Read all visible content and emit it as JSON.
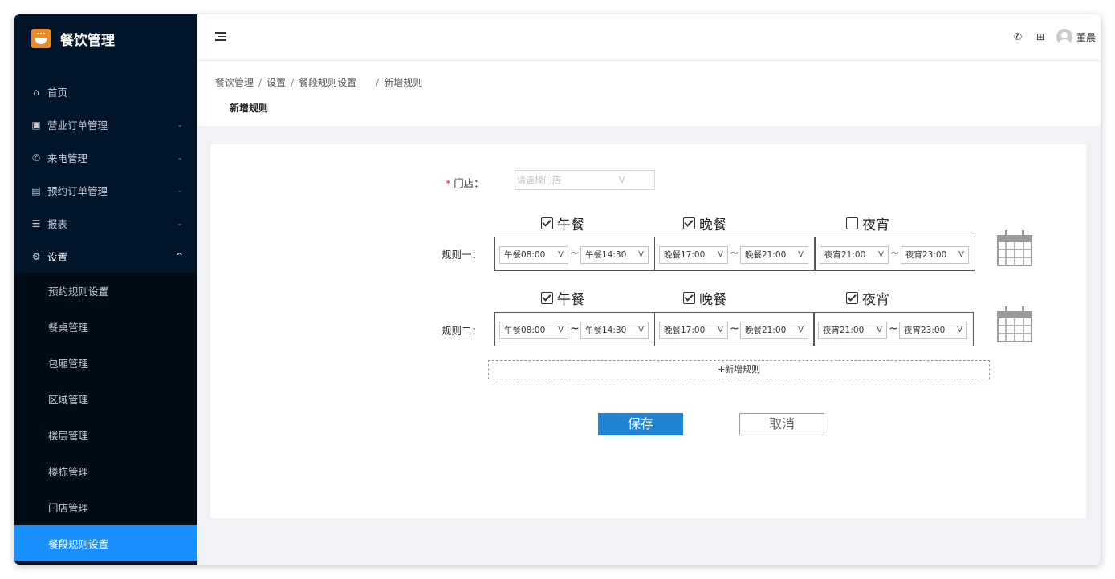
{
  "app": {
    "title": "餐饮管理"
  },
  "sidebar": {
    "items": [
      {
        "label": "首页",
        "icon": "home-icon"
      },
      {
        "label": "营业订单管理",
        "icon": "receipt-icon"
      },
      {
        "label": "来电管理",
        "icon": "phone-icon"
      },
      {
        "label": "预约订单管理",
        "icon": "calendar-list-icon"
      },
      {
        "label": "报表",
        "icon": "list-icon"
      },
      {
        "label": "设置",
        "icon": "gear-icon"
      }
    ],
    "submenu": [
      {
        "label": "预约规则设置"
      },
      {
        "label": "餐桌管理"
      },
      {
        "label": "包厢管理"
      },
      {
        "label": "区域管理"
      },
      {
        "label": "楼层管理"
      },
      {
        "label": "楼栋管理"
      },
      {
        "label": "门店管理"
      },
      {
        "label": "餐段规则设置"
      }
    ]
  },
  "header": {
    "username": "董晨"
  },
  "breadcrumb": [
    "餐饮管理",
    "设置",
    "餐段规则设置",
    "新增规则"
  ],
  "page_title": "新增规则",
  "form": {
    "store_label": "门店：",
    "store_placeholder": "请选择门店",
    "select_arrow": "V",
    "rules": [
      {
        "label": "规则一：",
        "meals": [
          {
            "name": "午餐",
            "checked": true,
            "start": "午餐08:00",
            "end": "午餐14:30"
          },
          {
            "name": "晚餐",
            "checked": true,
            "start": "晚餐17:00",
            "end": "晚餐21:00"
          },
          {
            "name": "夜宵",
            "checked": false,
            "start": "夜宵21:00",
            "end": "夜宵23:00"
          }
        ]
      },
      {
        "label": "规则二：",
        "meals": [
          {
            "name": "午餐",
            "checked": true,
            "start": "午餐08:00",
            "end": "午餐14:30"
          },
          {
            "name": "晚餐",
            "checked": true,
            "start": "晚餐17:00",
            "end": "晚餐21:00"
          },
          {
            "name": "夜宵",
            "checked": true,
            "start": "夜宵21:00",
            "end": "夜宵23:00"
          }
        ]
      }
    ],
    "tilde": "~",
    "add_rule": "+新增规则",
    "save": "保存",
    "cancel": "取消"
  },
  "colors": {
    "sidebar_bg": "#001529",
    "active": "#1890ff",
    "primary_button": "#1f84d4",
    "required": "#f5222d",
    "logo": "#f08a24"
  }
}
